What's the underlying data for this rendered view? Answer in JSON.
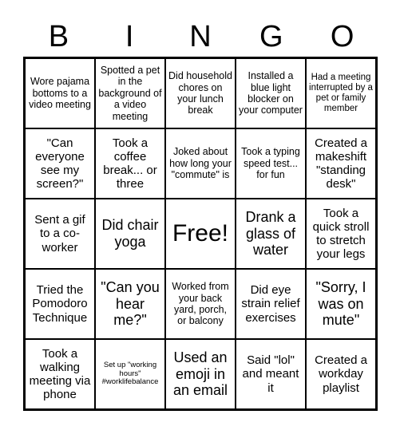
{
  "title_letters": [
    "B",
    "I",
    "N",
    "G",
    "O"
  ],
  "cells": [
    [
      "Wore pajama bottoms to a video meeting",
      "Spotted a pet in the background of a video meeting",
      "Did household chores on your lunch break",
      "Installed a blue light blocker on your computer",
      "Had a meeting interrupted by a pet or family member"
    ],
    [
      "\"Can everyone see my screen?\"",
      "Took a coffee break... or three",
      "Joked about how long your \"commute\" is",
      "Took a typing speed test... for fun",
      "Created a makeshift \"standing desk\""
    ],
    [
      "Sent a gif to a co-worker",
      "Did chair yoga",
      "Free!",
      "Drank a glass of water",
      "Took a quick stroll to stretch your legs"
    ],
    [
      "Tried the Pomodoro Technique",
      "\"Can you hear me?\"",
      "Worked from your back yard, porch, or balcony",
      "Did eye strain relief exercises",
      "\"Sorry, I was on mute\""
    ],
    [
      "Took a walking meeting via phone",
      "Set up \"working hours\" #worklifebalance",
      "Used an emoji in an email",
      "Said \"lol\" and meant it",
      "Created a workday playlist"
    ]
  ]
}
